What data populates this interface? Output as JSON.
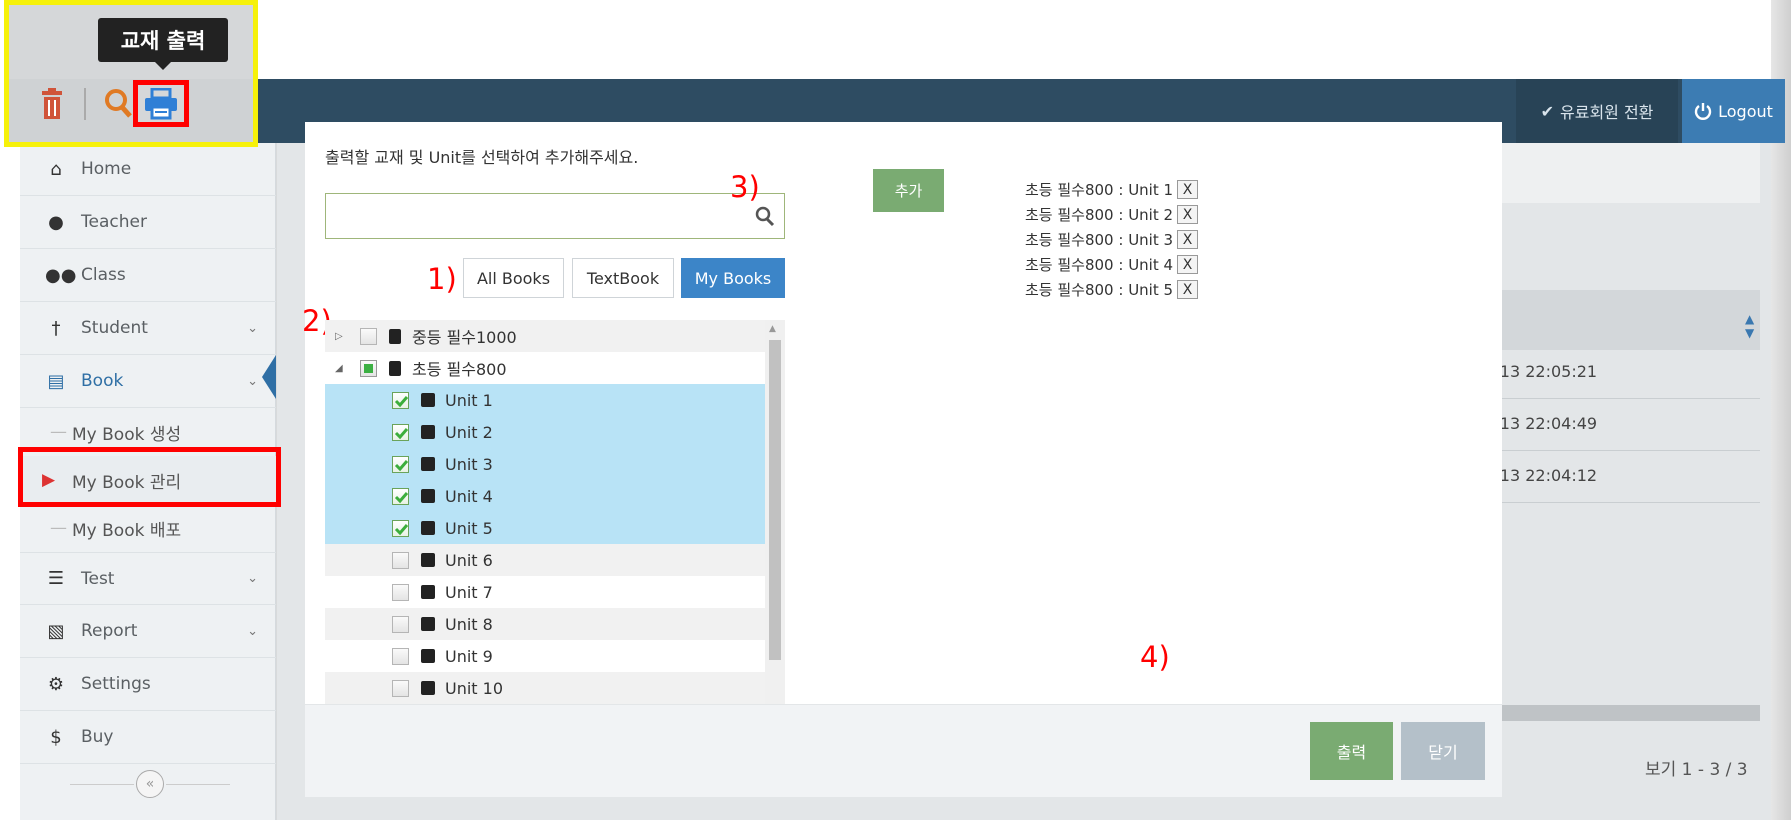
{
  "tooltip": {
    "text": "교재 출력"
  },
  "toolbar": {
    "icons": [
      "trash-icon",
      "search-icon",
      "printer-icon"
    ]
  },
  "header": {
    "upgrade_label": "유료회원 전환",
    "logout_label": "Logout"
  },
  "sidebar": {
    "items": [
      {
        "label": "Home",
        "icon": "home-icon"
      },
      {
        "label": "Teacher",
        "icon": "user-icon"
      },
      {
        "label": "Class",
        "icon": "group-icon"
      },
      {
        "label": "Student",
        "icon": "student-icon"
      },
      {
        "label": "Book",
        "icon": "book-icon"
      },
      {
        "label": "Test",
        "icon": "list-icon"
      },
      {
        "label": "Report",
        "icon": "bar-chart-icon"
      },
      {
        "label": "Settings",
        "icon": "gear-icon"
      },
      {
        "label": "Buy",
        "icon": "dollar-icon"
      }
    ],
    "book_sub": [
      {
        "label": "My Book 생성"
      },
      {
        "label": "My Book 관리"
      },
      {
        "label": "My Book 배포"
      }
    ]
  },
  "background": {
    "timestamps": [
      "-13 22:05:21",
      "-13 22:04:49",
      "-13 22:04:12"
    ],
    "paging": "보기 1 - 3 / 3"
  },
  "modal": {
    "instruction": "출력할 교재 및 Unit를 선택하여 추가해주세요.",
    "search": {
      "value": "",
      "placeholder": ""
    },
    "filters": [
      "All Books",
      "TextBook",
      "My Books"
    ],
    "active_filter": "My Books",
    "steps": [
      "1)",
      "2)",
      "3)",
      "4)"
    ],
    "tree": [
      {
        "label": "중등 필수1000",
        "expanded": false,
        "checked": "none"
      },
      {
        "label": "초등 필수800",
        "expanded": true,
        "checked": "partial"
      }
    ],
    "units": [
      {
        "label": "Unit 1",
        "checked": true
      },
      {
        "label": "Unit 2",
        "checked": true
      },
      {
        "label": "Unit 3",
        "checked": true
      },
      {
        "label": "Unit 4",
        "checked": true
      },
      {
        "label": "Unit 5",
        "checked": true
      },
      {
        "label": "Unit 6",
        "checked": false
      },
      {
        "label": "Unit 7",
        "checked": false
      },
      {
        "label": "Unit 8",
        "checked": false
      },
      {
        "label": "Unit 9",
        "checked": false
      },
      {
        "label": "Unit 10",
        "checked": false
      }
    ],
    "add_label": "추가",
    "selected": [
      {
        "label": "초등 필수800 : Unit 1",
        "remove": "X"
      },
      {
        "label": "초등 필수800 : Unit 2",
        "remove": "X"
      },
      {
        "label": "초등 필수800 : Unit 3",
        "remove": "X"
      },
      {
        "label": "초등 필수800 : Unit 4",
        "remove": "X"
      },
      {
        "label": "초등 필수800 : Unit 5",
        "remove": "X"
      }
    ],
    "print_label": "출력",
    "close_label": "닫기"
  },
  "colors": {
    "topbar": "#2e4c62",
    "accent_blue": "#3c85c8",
    "green_button": "#7aab72",
    "highlight_yellow": "#f6f10a",
    "highlight_red": "#ff0000",
    "selected_row": "#b8e3f6"
  }
}
